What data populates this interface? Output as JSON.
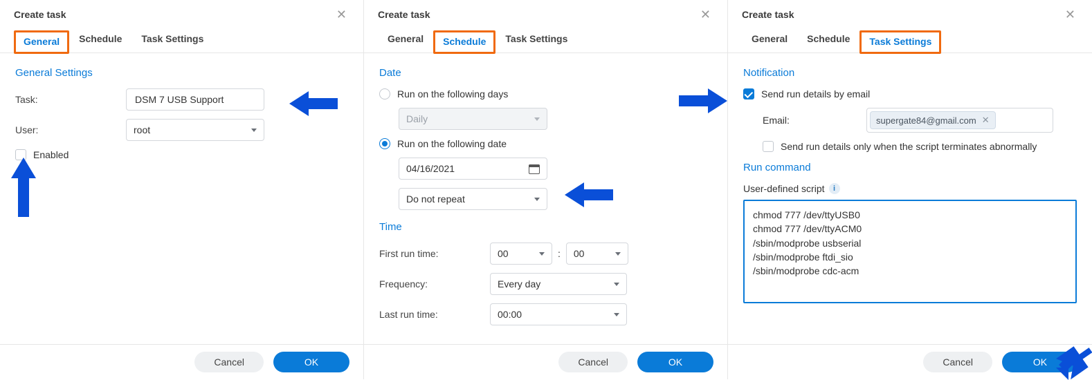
{
  "colors": {
    "accent": "#0a7bd8",
    "highlight_box": "#f06a10",
    "arrow": "#0a4fd8"
  },
  "shared": {
    "window_title": "Create task",
    "tabs": {
      "general": "General",
      "schedule": "Schedule",
      "task_settings": "Task Settings"
    },
    "buttons": {
      "cancel": "Cancel",
      "ok": "OK"
    }
  },
  "panel1": {
    "active_tab": "general",
    "section_title": "General Settings",
    "task_label": "Task:",
    "task_value": "DSM 7 USB Support",
    "user_label": "User:",
    "user_value": "root",
    "enabled_label": "Enabled",
    "enabled_checked": false
  },
  "panel2": {
    "active_tab": "schedule",
    "date_section": "Date",
    "run_days_label": "Run on the following days",
    "run_days_value": "Daily",
    "run_days_selected": false,
    "run_date_label": "Run on the following date",
    "run_date_selected": true,
    "date_value": "04/16/2021",
    "repeat_value": "Do not repeat",
    "time_section": "Time",
    "first_run_label": "First run time:",
    "first_run_hour": "00",
    "first_run_min": "00",
    "time_sep": ":",
    "frequency_label": "Frequency:",
    "frequency_value": "Every day",
    "last_run_label": "Last run time:",
    "last_run_value": "00:00"
  },
  "panel3": {
    "active_tab": "task_settings",
    "notification_section": "Notification",
    "send_email_label": "Send run details by email",
    "send_email_checked": true,
    "email_label": "Email:",
    "email_value": "supergate84@gmail.com",
    "abnormal_label": "Send run details only when the script terminates abnormally",
    "abnormal_checked": false,
    "run_cmd_section": "Run command",
    "script_label": "User-defined script",
    "info_glyph": "i",
    "script_value": "chmod 777 /dev/ttyUSB0\nchmod 777 /dev/ttyACM0\n/sbin/modprobe usbserial\n/sbin/modprobe ftdi_sio\n/sbin/modprobe cdc-acm"
  }
}
